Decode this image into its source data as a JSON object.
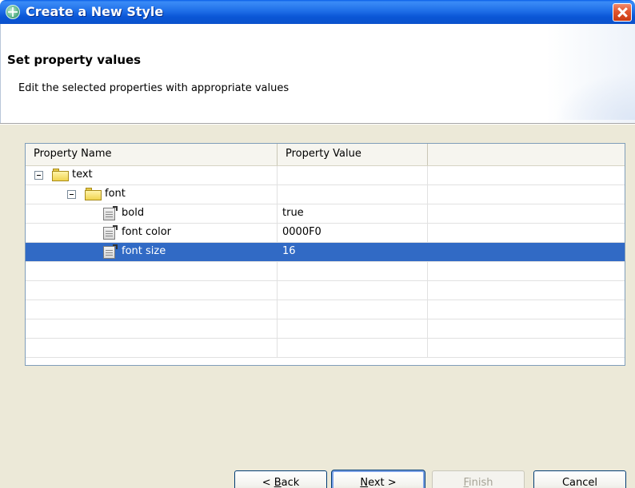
{
  "window": {
    "title": "Create a New Style"
  },
  "header": {
    "title": "Set property values",
    "description": "Edit the selected properties with appropriate values"
  },
  "table": {
    "columns": [
      "Property Name",
      "Property Value",
      ""
    ],
    "rows": [
      {
        "name": "text",
        "value": "",
        "kind": "folder",
        "level": 0,
        "expanded": true
      },
      {
        "name": "font",
        "value": "",
        "kind": "folder",
        "level": 1,
        "expanded": true
      },
      {
        "name": "bold",
        "value": "true",
        "kind": "property",
        "level": 2
      },
      {
        "name": "font color",
        "value": "0000F0",
        "kind": "property",
        "level": 2
      },
      {
        "name": "font size",
        "value": "16",
        "kind": "property",
        "level": 2,
        "selected": true
      }
    ]
  },
  "buttons": {
    "back": {
      "prefix": "< ",
      "mnemonic": "B",
      "rest": "ack"
    },
    "next": {
      "mnemonic": "N",
      "rest": "ext >"
    },
    "finish": {
      "mnemonic": "F",
      "rest": "inish"
    },
    "cancel": {
      "label": "Cancel"
    }
  },
  "colors": {
    "selection": "#316ac5",
    "titlebar": "#0a56d6",
    "dialog_background": "#ece9d8"
  }
}
